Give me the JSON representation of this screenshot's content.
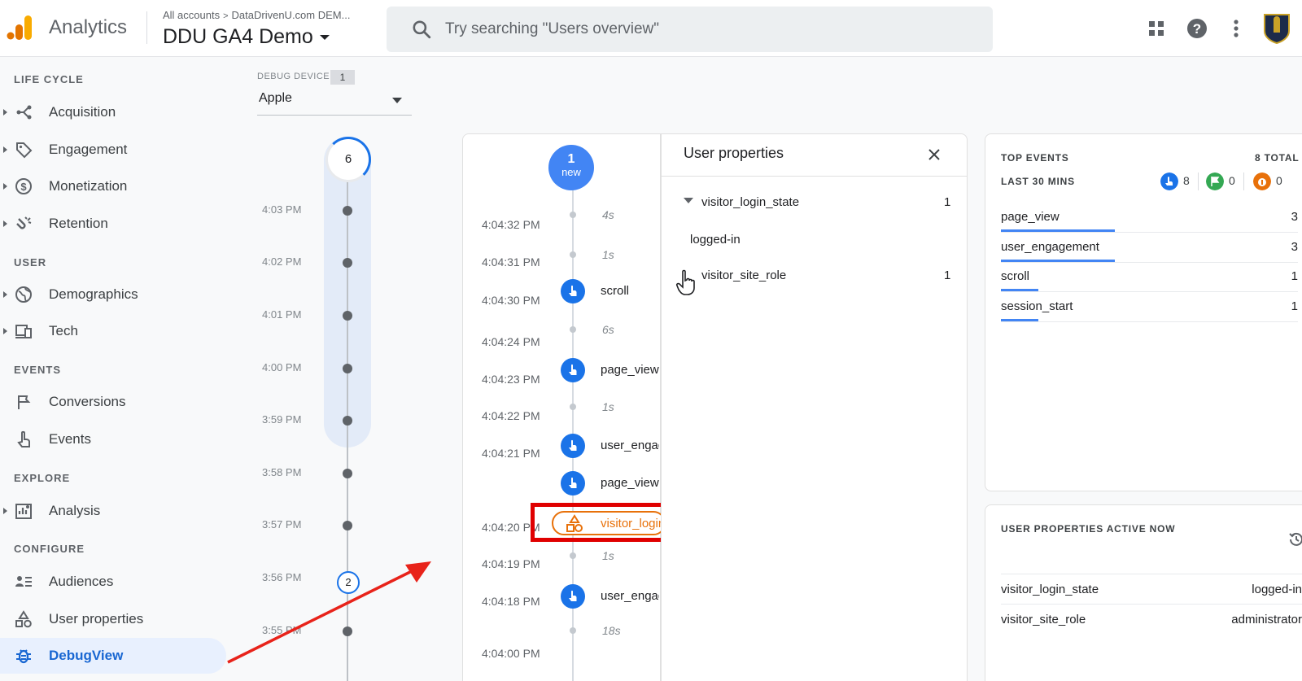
{
  "header": {
    "app_name": "Analytics",
    "breadcrumb": {
      "root": "All accounts",
      "account": "DataDrivenU.com DEM..."
    },
    "property": "DDU GA4 Demo",
    "search_placeholder": "Try searching \"Users overview\"",
    "icons": [
      "apps-grid-icon",
      "help-icon",
      "more-vert-icon",
      "account-avatar"
    ]
  },
  "sidebar": {
    "sections": [
      {
        "label": "LIFE CYCLE",
        "items": [
          {
            "label": "Acquisition",
            "icon": "acquisition-icon",
            "expandable": true
          },
          {
            "label": "Engagement",
            "icon": "tag-icon",
            "expandable": true
          },
          {
            "label": "Monetization",
            "icon": "dollar-icon",
            "expandable": true
          },
          {
            "label": "Retention",
            "icon": "magnet-icon",
            "expandable": true
          }
        ]
      },
      {
        "label": "USER",
        "items": [
          {
            "label": "Demographics",
            "icon": "globe-icon",
            "expandable": true
          },
          {
            "label": "Tech",
            "icon": "devices-icon",
            "expandable": true
          }
        ]
      },
      {
        "label": "EVENTS",
        "items": [
          {
            "label": "Conversions",
            "icon": "flag-icon",
            "expandable": false
          },
          {
            "label": "Events",
            "icon": "touch-icon",
            "expandable": false
          }
        ]
      },
      {
        "label": "EXPLORE",
        "items": [
          {
            "label": "Analysis",
            "icon": "analysis-icon",
            "expandable": true
          }
        ]
      },
      {
        "label": "CONFIGURE",
        "items": [
          {
            "label": "Audiences",
            "icon": "audiences-icon",
            "expandable": false
          },
          {
            "label": "User properties",
            "icon": "shapes-icon",
            "expandable": false
          },
          {
            "label": "DebugView",
            "icon": "bug-icon",
            "expandable": false,
            "active": true
          }
        ]
      }
    ]
  },
  "debug_device": {
    "label": "DEBUG DEVICE",
    "count": "1",
    "selected": "Apple"
  },
  "minute_stream": {
    "top_count": "6",
    "minutes": [
      "4:03 PM",
      "4:02 PM",
      "4:01 PM",
      "4:00 PM",
      "3:59 PM",
      "3:58 PM",
      "3:57 PM",
      "3:56 PM",
      "3:55 PM"
    ],
    "badge_count": "2"
  },
  "seconds_stream": {
    "new_count": "1",
    "new_label": "new",
    "timestamps": [
      "4:04:32 PM",
      "4:04:31 PM",
      "4:04:30 PM",
      "4:04:24 PM",
      "4:04:23 PM",
      "4:04:22 PM",
      "4:04:21 PM",
      "4:04:20 PM",
      "4:04:19 PM",
      "4:04:18 PM",
      "4:04:00 PM"
    ],
    "gaps": [
      "4s",
      "1s",
      "6s",
      "1s",
      "1s",
      "18s"
    ],
    "events": [
      "scroll",
      "page_view",
      "user_engagement",
      "page_view",
      "visitor_login_state",
      "user_engagement"
    ]
  },
  "user_properties_panel": {
    "title": "User properties",
    "properties": [
      {
        "key": "visitor_login_state",
        "count": "1",
        "expanded": true,
        "value": "logged-in"
      },
      {
        "key": "visitor_site_role",
        "count": "1",
        "expanded": false
      }
    ]
  },
  "top_events": {
    "title": "TOP EVENTS",
    "total": "8 TOTAL",
    "subtitle": "LAST 30 MINS",
    "counts": {
      "standard": "8",
      "conversion": "0",
      "error": "0"
    },
    "events": [
      {
        "name": "page_view",
        "value": "3",
        "share": 1.0
      },
      {
        "name": "user_engagement",
        "value": "3",
        "share": 1.0
      },
      {
        "name": "scroll",
        "value": "1",
        "share": 0.33
      },
      {
        "name": "session_start",
        "value": "1",
        "share": 0.33
      }
    ]
  },
  "user_properties_active": {
    "title": "USER PROPERTIES ACTIVE NOW",
    "rows": [
      {
        "key": "visitor_login_state",
        "value": "logged-in"
      },
      {
        "key": "visitor_site_role",
        "value": "administrator"
      }
    ]
  },
  "colors": {
    "accent": "#1a73e8",
    "highlight": "#e8710a",
    "annotation": "#e00000",
    "conversion": "#34a853"
  }
}
